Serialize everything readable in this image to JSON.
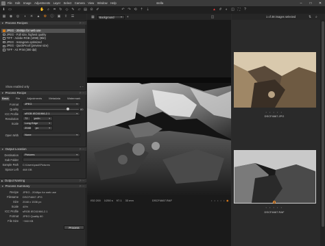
{
  "window": {
    "title": "stella",
    "menu": [
      "File",
      "Edit",
      "Image",
      "Adjustments",
      "Layer",
      "Select",
      "Camera",
      "View",
      "Window",
      "Help"
    ],
    "controls": [
      "–",
      "□",
      "✕"
    ]
  },
  "toolbar": {
    "icons": [
      "import-icon",
      "folder-icon",
      "hand-icon",
      "zoom-icon",
      "crop-icon",
      "rotate-icon",
      "keystone-icon",
      "brush-icon",
      "eraser-icon",
      "gradient-icon",
      "picker-icon",
      "annotation-icon",
      "undo-icon",
      "redo-icon",
      "reset-icon",
      "copy-icon",
      "paste-icon",
      "warning-icon",
      "grid-icon",
      "proof-icon",
      "compare-icon",
      "fullscreen-icon",
      "help-icon"
    ]
  },
  "left_tabs": [
    "library",
    "capture",
    "lens",
    "color",
    "exposure",
    "details",
    "output",
    "metadata",
    "adjust",
    "export",
    "batch"
  ],
  "process_recipes": {
    "header": "Process Recipes",
    "items": [
      {
        "label": "JPEG - 2048px for web use",
        "checked": true,
        "selected": true
      },
      {
        "label": "JPEG - Full size, highest quality",
        "checked": false,
        "selected": false
      },
      {
        "label": "TIFF - Adobe RGB (1998) (8bit)",
        "checked": false,
        "selected": false
      },
      {
        "label": "JPEG - Instagram optimized",
        "checked": false,
        "selected": false
      },
      {
        "label": "JPEG - QuickProof (preview size)",
        "checked": false,
        "selected": false
      },
      {
        "label": "TIFF - A2 Print (300 dpi)",
        "checked": false,
        "selected": false
      }
    ],
    "show_enabled": "Show enabled only"
  },
  "process_recipe": {
    "header": "Process Recipe",
    "tabs": [
      "Basic",
      "File",
      "Adjustments",
      "Metadata",
      "Watermark"
    ],
    "format": {
      "label": "Format",
      "value": "JPEG"
    },
    "quality": {
      "label": "Quality",
      "value": "80",
      "fraction": 0.8
    },
    "icc": {
      "label": "ICC Profile",
      "value": "sRGB IEC61966-2.1"
    },
    "resolution": {
      "label": "Resolution",
      "value": "72",
      "unit": "px/in"
    },
    "scale": {
      "label": "Scale",
      "value": "Long Edge"
    },
    "scale_size": {
      "value": "2048",
      "unit": "px"
    },
    "open_with": {
      "label": "Open With",
      "value": "None"
    }
  },
  "output_location": {
    "header": "Output Location",
    "destination": {
      "label": "Destination",
      "value": "Pictures"
    },
    "subfolder": {
      "label": "Sub Folder",
      "value": ""
    },
    "sample_path": {
      "label": "Sample Path",
      "value": "C:\\Users\\paul\\Pictures"
    },
    "space_left": {
      "label": "Space Left",
      "value": "468 GB"
    }
  },
  "output_naming": {
    "header": "Output Naming"
  },
  "process_summary": {
    "header": "Process Summary",
    "recipe": {
      "label": "Recipe",
      "value": "JPEG - 2048px for web use"
    },
    "filename": {
      "label": "Filename",
      "value": "DSCF4667.JPG"
    },
    "size": {
      "label": "Size",
      "value": "2048 x 1536 px"
    },
    "scale": {
      "label": "Scale",
      "value": "40%"
    },
    "icc": {
      "label": "ICC Profile",
      "value": "sRGB IEC61966-2.1"
    },
    "format": {
      "label": "Format",
      "value": "JPEG Quality 80"
    },
    "filesize": {
      "label": "File Size",
      "value": "~940 KB"
    },
    "button": "Process"
  },
  "viewer": {
    "background": "Background",
    "info": {
      "iso": "ISO 200",
      "shutter": "1/250 s",
      "aperture": "f/7.1",
      "focal": "33 mm",
      "filename": "DSCF4667.RAF"
    }
  },
  "browser": {
    "count": "1 of 28 images selected",
    "thumbs": [
      {
        "label": "DSCF4667.JPG",
        "selected": false
      },
      {
        "label": "DSCF4667.RAF",
        "selected": true
      }
    ]
  },
  "colors": {
    "accent": "#ff8c1a",
    "panel": "#2b2b2b",
    "toolbar": "#1f1f1f",
    "selection": "#535353"
  }
}
